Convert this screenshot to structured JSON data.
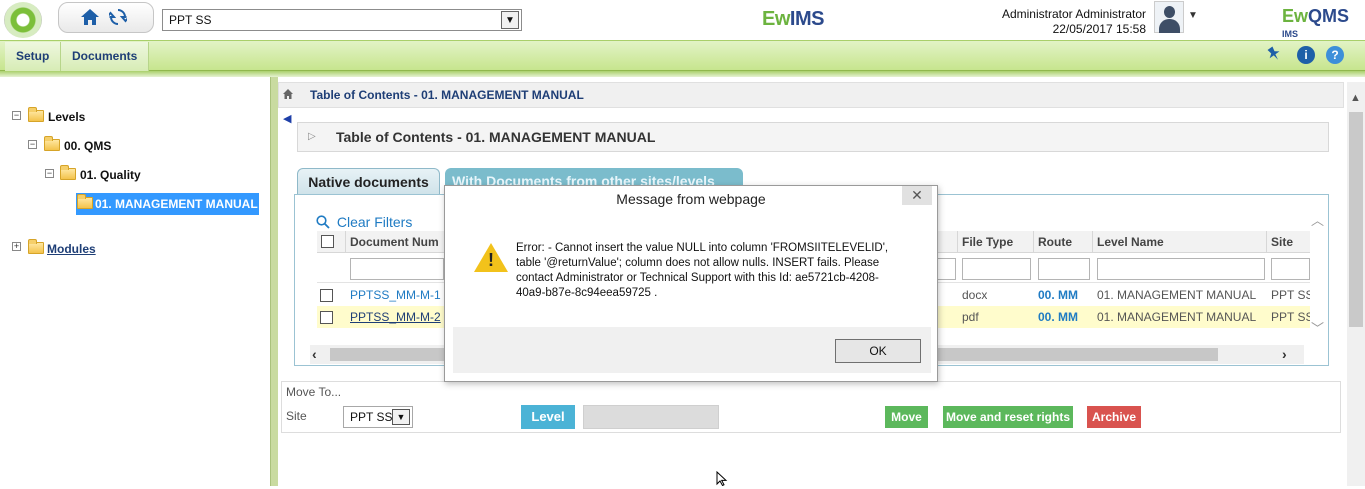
{
  "header": {
    "site_value": "PPT SS",
    "brand_center": {
      "prefix": "Ew",
      "suffix": "IMS"
    },
    "user_name": "Administrator Administrator",
    "datetime": "22/05/2017 15:58",
    "brand_right": {
      "prefix": "Ew",
      "suffix": "QMS",
      "superscript": "IMS"
    }
  },
  "menu": {
    "setup_label": "Setup",
    "documents_label": "Documents",
    "info_glyph": "i",
    "help_glyph": "?"
  },
  "tree": {
    "levels": "Levels",
    "qms": "00. QMS",
    "quality": "01. Quality",
    "manual": "01. MANAGEMENT MANUAL",
    "modules": "Modules"
  },
  "content": {
    "breadcrumb": "Table of Contents - 01. MANAGEMENT MANUAL",
    "panel_title": "Table of Contents - 01. MANAGEMENT MANUAL",
    "tab_native": "Native documents",
    "tab_other": "With Documents from other sites/levels",
    "clear_filters": "Clear Filters"
  },
  "table": {
    "columns": [
      "Document Num",
      "File Type",
      "Route",
      "Level Name",
      "Site"
    ],
    "rows": [
      {
        "doc": "PPTSS_MM-M-1",
        "type": "docx",
        "route": "00. MM",
        "level": "01. MANAGEMENT MANUAL",
        "site": "PPT SS"
      },
      {
        "doc": "PPTSS_MM-M-2",
        "type": "pdf",
        "route": "00. MM",
        "level": "01. MANAGEMENT MANUAL",
        "site": "PPT SS"
      }
    ]
  },
  "move_panel": {
    "title": "Move To...",
    "site_label": "Site",
    "site_value": "PPT SS",
    "level_button": "Level",
    "move_button": "Move",
    "move_reset_button": "Move and reset rights",
    "archive_button": "Archive"
  },
  "dialog": {
    "title": "Message from webpage",
    "message": "Error: - Cannot insert the value NULL into column 'FROMSIITELEVELID', table '@returnValue'; column does not allow nulls. INSERT fails. Please contact Administrator or Technical Support with this Id: ae5721cb-4208-40a9-b87e-8c94eea59725 .",
    "ok_label": "OK",
    "warning_glyph": "!",
    "close_glyph": "✕"
  },
  "colors": {
    "menu_bar": "#c7e58e",
    "link_blue": "#1f7bc3",
    "selected_node": "#3399ff",
    "move_green": "#5cb85c",
    "archive_red": "#d9534f",
    "level_blue": "#4bb3d6"
  }
}
